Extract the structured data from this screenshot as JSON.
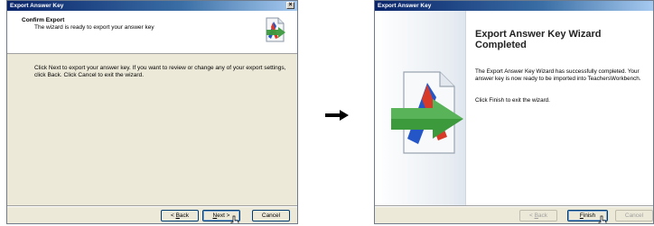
{
  "dialog1": {
    "title": "Export Answer Key",
    "close_glyph": "×",
    "header_title": "Confirm Export",
    "header_subtitle": "The wizard is ready to export your answer key",
    "header_icon": "export-icon",
    "body_text": "Click Next to export your answer key. If you want to review or change any of your export settings, click Back. Click Cancel to exit the wizard.",
    "buttons": {
      "back_pre": "< ",
      "back_u": "B",
      "back_post": "ack",
      "next_u": "N",
      "next_post": "ext >",
      "cancel": "Cancel"
    }
  },
  "transition_arrow": "arrow-right-icon",
  "dialog2": {
    "title": "Export Answer Key",
    "heading": "Export Answer Key Wizard Completed",
    "body_text": "The Export Answer Key Wizard has successfully completed. Your answer key is now ready to be imported into TeachersWorkbench.",
    "finish_text": "Click Finish to exit the wizard.",
    "buttons": {
      "back_pre": "< ",
      "back_u": "B",
      "back_post": "ack",
      "finish_u": "F",
      "finish_post": "inish",
      "cancel": "Cancel"
    }
  },
  "colors": {
    "titlebar": "#0a246a",
    "dialog_bg": "#ece9d8",
    "arrow_green": "#3c9a3c",
    "art_blue": "#2456c8",
    "art_red": "#d83a2a"
  }
}
